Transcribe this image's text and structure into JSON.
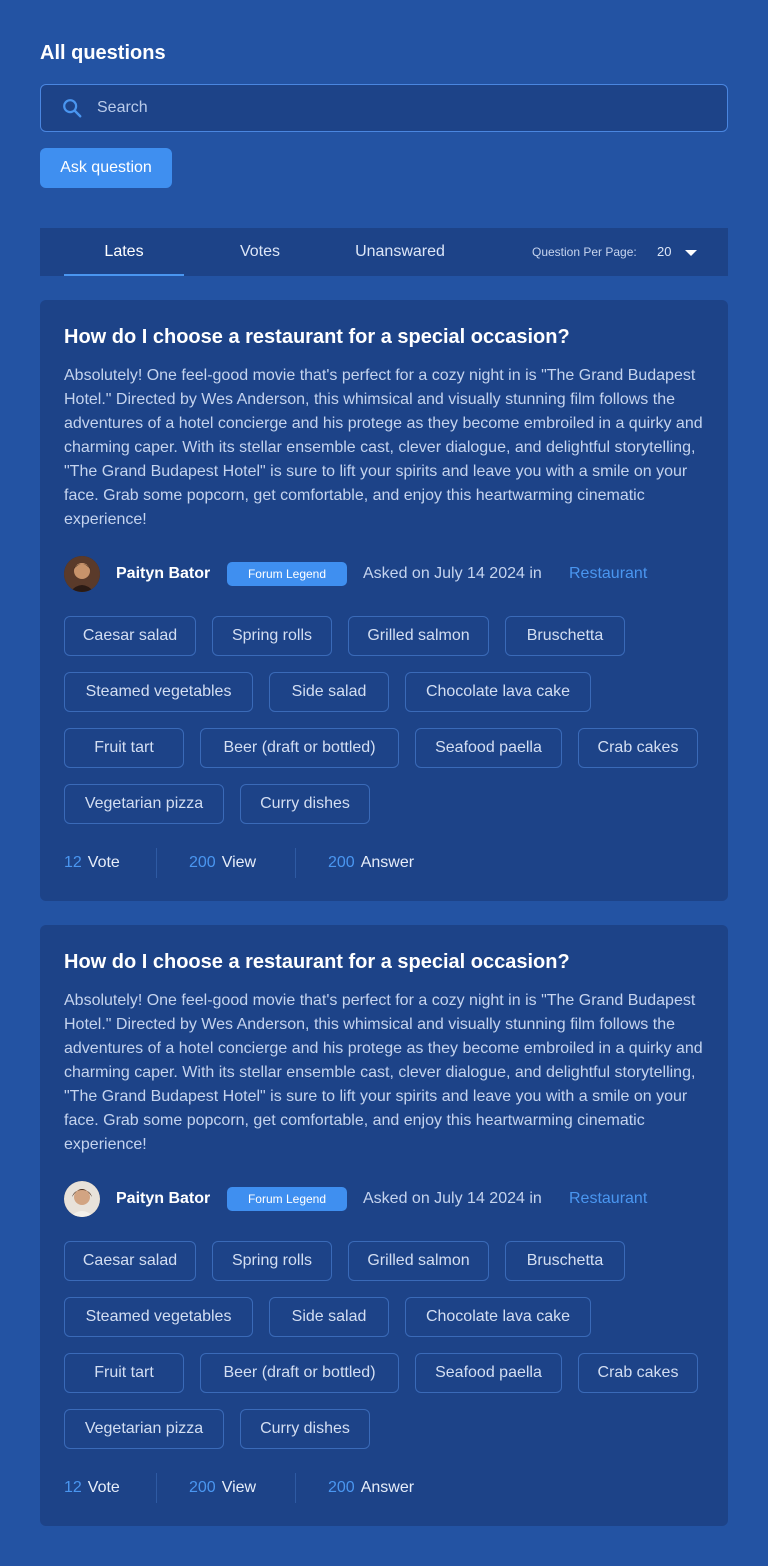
{
  "page_title": "All questions",
  "search": {
    "placeholder": "Search",
    "value": ""
  },
  "ask_button_label": "Ask question",
  "tabs": [
    {
      "label": "Lates",
      "active": true
    },
    {
      "label": "Votes",
      "active": false
    },
    {
      "label": "Unanswared",
      "active": false
    }
  ],
  "per_page": {
    "label": "Question Per Page:",
    "value": "20"
  },
  "colors": {
    "background": "#2353a3",
    "card": "#1d4388",
    "accent": "#3f8ff0",
    "link": "#4a96f0"
  },
  "questions": [
    {
      "title": "How do I choose a restaurant for a special occasion?",
      "body": "Absolutely! One feel-good movie that's perfect for a cozy night in is \"The Grand Budapest Hotel.\" Directed by Wes Anderson, this whimsical and visually stunning film follows the adventures of a hotel concierge and his protege as they become embroiled in a quirky and charming caper. With its stellar ensemble cast, clever dialogue, and delightful storytelling, \"The Grand Budapest Hotel\" is sure to lift your spirits and leave you with a smile on your face. Grab some popcorn, get comfortable, and enjoy this heartwarming cinematic experience!",
      "author": "Paityn Bator",
      "badge": "Forum Legend",
      "asked": "Asked on July 14 2024 in",
      "category": "Restaurant",
      "tags": [
        "Caesar salad",
        "Spring rolls",
        "Grilled salmon",
        "Bruschetta",
        "Steamed vegetables",
        "Side salad",
        "Chocolate lava cake",
        "Fruit tart",
        "Beer (draft or bottled)",
        "Seafood paella",
        "Crab cakes",
        "Vegetarian pizza",
        "Curry dishes"
      ],
      "votes": {
        "count": "12",
        "label": "Vote"
      },
      "views": {
        "count": "200",
        "label": "View"
      },
      "answers": {
        "count": "200",
        "label": "Answer"
      }
    },
    {
      "title": "How do I choose a restaurant for a special occasion?",
      "body": "Absolutely! One feel-good movie that's perfect for a cozy night in is \"The Grand Budapest Hotel.\" Directed by Wes Anderson, this whimsical and visually stunning film follows the adventures of a hotel concierge and his protege as they become embroiled in a quirky and charming caper. With its stellar ensemble cast, clever dialogue, and delightful storytelling, \"The Grand Budapest Hotel\" is sure to lift your spirits and leave you with a smile on your face. Grab some popcorn, get comfortable, and enjoy this heartwarming cinematic experience!",
      "author": "Paityn Bator",
      "badge": "Forum Legend",
      "asked": "Asked on July 14 2024 in",
      "category": "Restaurant",
      "tags": [
        "Caesar salad",
        "Spring rolls",
        "Grilled salmon",
        "Bruschetta",
        "Steamed vegetables",
        "Side salad",
        "Chocolate lava cake",
        "Fruit tart",
        "Beer (draft or bottled)",
        "Seafood paella",
        "Crab cakes",
        "Vegetarian pizza",
        "Curry dishes"
      ],
      "votes": {
        "count": "12",
        "label": "Vote"
      },
      "views": {
        "count": "200",
        "label": "View"
      },
      "answers": {
        "count": "200",
        "label": "Answer"
      }
    }
  ]
}
